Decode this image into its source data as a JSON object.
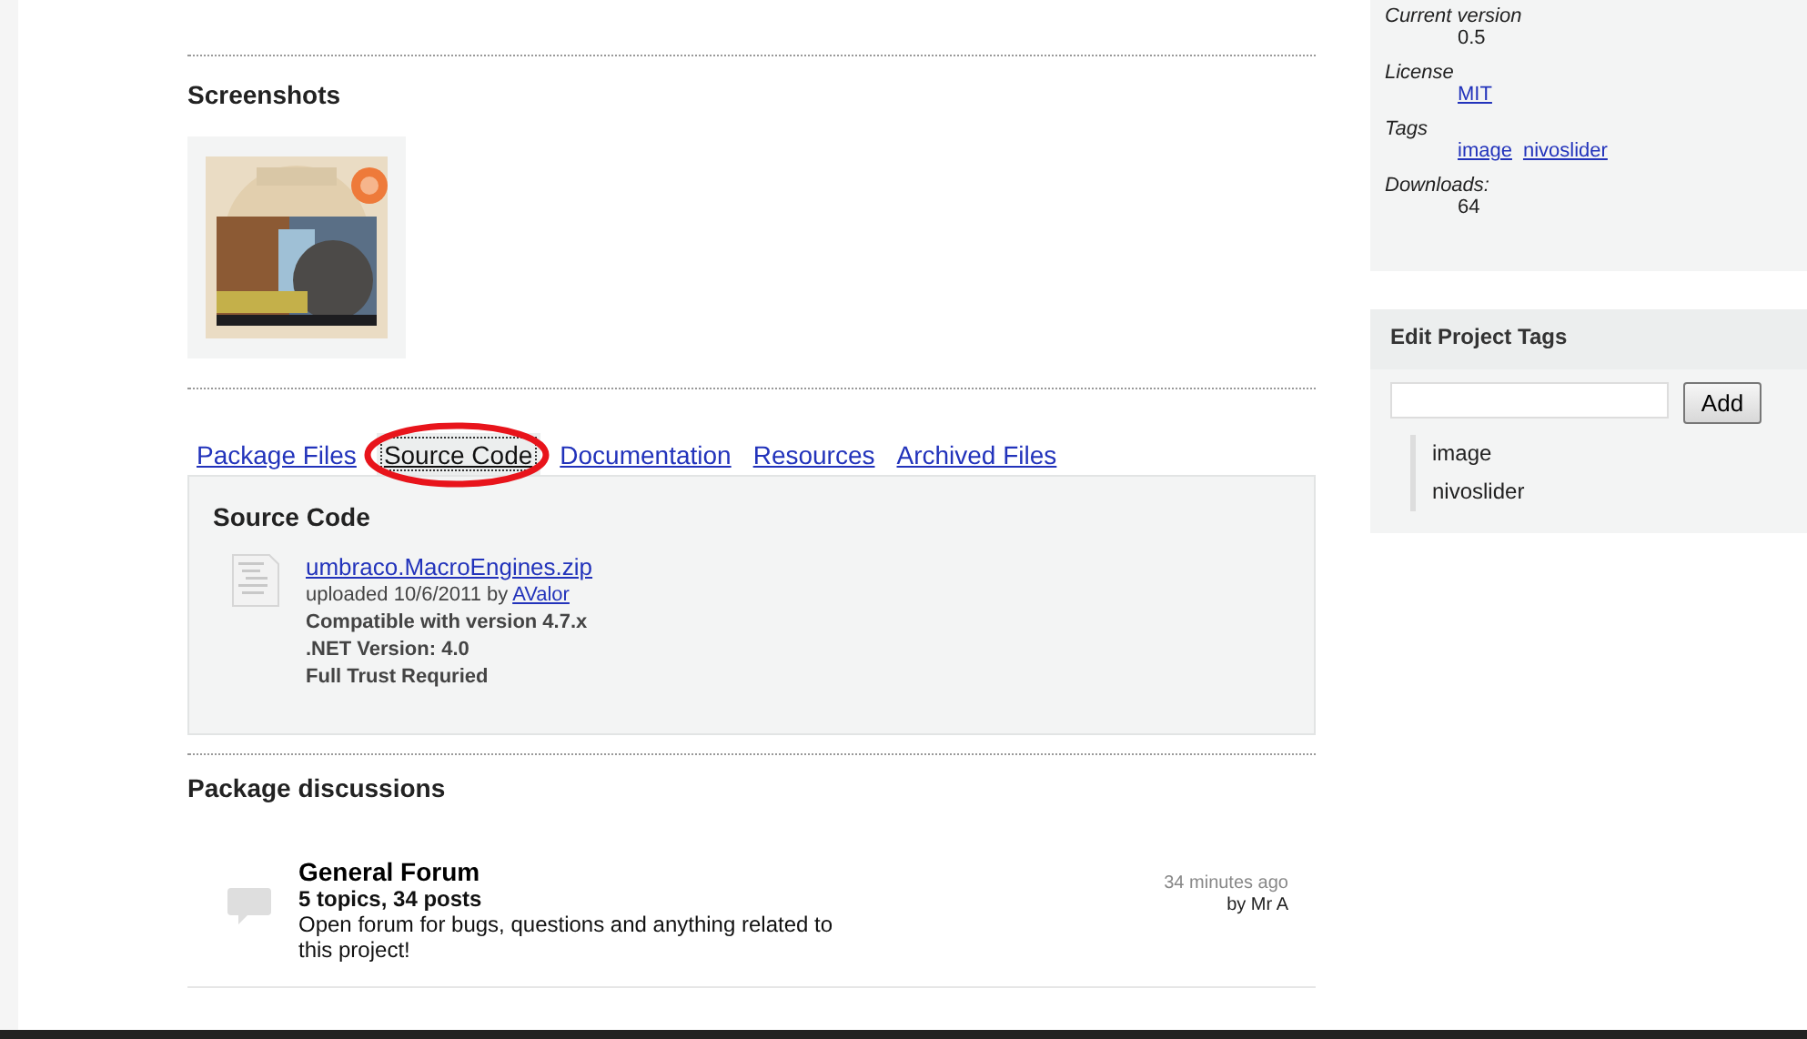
{
  "screenshots": {
    "heading": "Screenshots"
  },
  "tabs": [
    {
      "label": "Package Files",
      "selected": false,
      "circled": false
    },
    {
      "label": "Source Code",
      "selected": true,
      "circled": true
    },
    {
      "label": "Documentation",
      "selected": false,
      "circled": false
    },
    {
      "label": "Resources",
      "selected": false,
      "circled": false
    },
    {
      "label": "Archived Files",
      "selected": false,
      "circled": false
    }
  ],
  "panel": {
    "heading": "Source Code",
    "files": [
      {
        "name": "umbraco.MacroEngines.zip",
        "uploaded": "uploaded 10/6/2011 by",
        "uploader": "AValor",
        "details": [
          "Compatible with version 4.7.x",
          ".NET Version: 4.0",
          "Full Trust Requried"
        ]
      }
    ]
  },
  "discussions": {
    "heading": "Package discussions",
    "forums": [
      {
        "title": "General Forum",
        "counts": "5 topics, 34 posts",
        "description": "Open forum for bugs, questions and anything related to this project!",
        "time": "34 minutes ago",
        "author": "by Mr A"
      }
    ]
  },
  "info": {
    "rows": [
      {
        "label": "Current version",
        "values": [
          {
            "text": "0.5",
            "link": false
          }
        ]
      },
      {
        "label": "License",
        "values": [
          {
            "text": "MIT",
            "link": true
          }
        ]
      },
      {
        "label": "Tags",
        "values": [
          {
            "text": "image",
            "link": true
          },
          {
            "text": "nivoslider",
            "link": true
          }
        ]
      },
      {
        "label": "Downloads:",
        "values": [
          {
            "text": "64",
            "link": false
          }
        ]
      }
    ]
  },
  "edit_tags": {
    "heading": "Edit Project Tags",
    "button": "Add",
    "tags": [
      "image",
      "nivoslider"
    ]
  }
}
